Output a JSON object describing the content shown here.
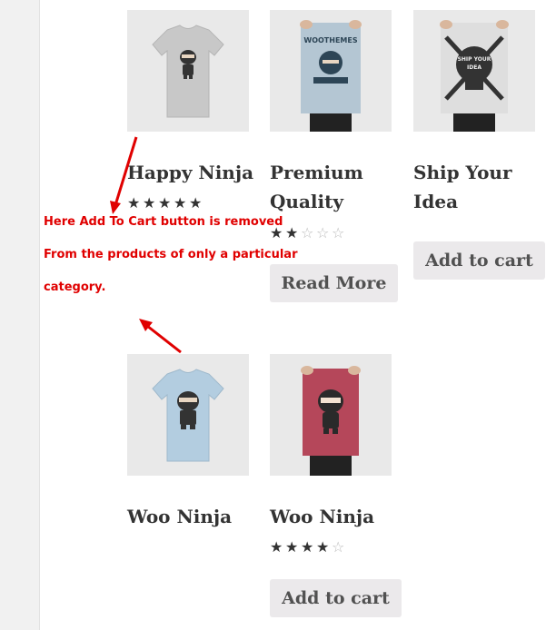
{
  "products": [
    {
      "name": "Happy Ninja",
      "title_lines": [
        "Happy Ninja"
      ],
      "rating": 5,
      "button": null,
      "image": "tshirt-gray-ninja"
    },
    {
      "name": "Premium Quality",
      "title_lines": [
        "Premium",
        "Quality"
      ],
      "rating": 2,
      "button": "Read More",
      "image": "poster-woothemes"
    },
    {
      "name": "Ship Your Idea",
      "title_lines": [
        "Ship Your",
        "Idea"
      ],
      "rating": 0,
      "button": "Add to cart",
      "image": "poster-skull"
    },
    {
      "name": "Woo Ninja",
      "title_lines": [
        "Woo Ninja"
      ],
      "rating": 0,
      "button": null,
      "image": "tshirt-blue-ninja"
    },
    {
      "name": "Woo Ninja",
      "title_lines": [
        "Woo Ninja"
      ],
      "rating": 4,
      "button": "Add to cart",
      "image": "poster-red-ninja"
    }
  ],
  "annotation": {
    "line1": "Here Add To Cart button is removed",
    "line2": "From the products of only a particular",
    "line3": "category.",
    "color": "#e00000"
  },
  "poster_text": {
    "woothemes": "WOOTHEMES",
    "ship": "SHIP YOUR",
    "idea": "IDEA"
  },
  "colors": {
    "star": "#333333",
    "button_bg": "#ebe9eb",
    "sidebar": "#f1f1f1"
  }
}
